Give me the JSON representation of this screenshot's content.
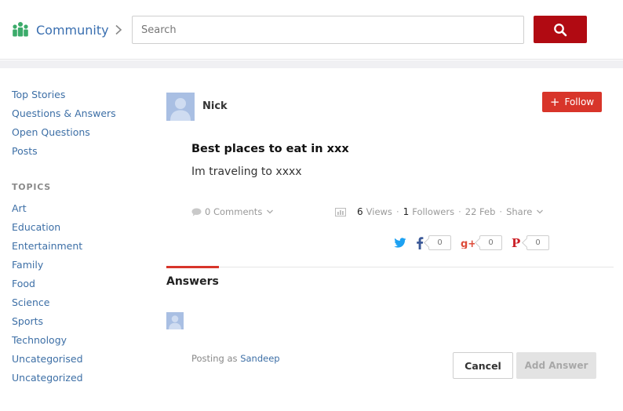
{
  "header": {
    "brand_label": "Community",
    "brand_icon": "community-people-icon",
    "search_placeholder": "Search",
    "search_value": "",
    "search_button_icon": "search-icon",
    "accent_color": "#b10a12"
  },
  "sidebar": {
    "nav": [
      {
        "label": "Top Stories"
      },
      {
        "label": "Questions & Answers"
      },
      {
        "label": "Open Questions"
      },
      {
        "label": "Posts"
      }
    ],
    "topics_heading": "TOPICS",
    "topics": [
      {
        "label": "Art"
      },
      {
        "label": "Education"
      },
      {
        "label": "Entertainment"
      },
      {
        "label": "Family"
      },
      {
        "label": "Food"
      },
      {
        "label": "Science"
      },
      {
        "label": "Sports"
      },
      {
        "label": "Technology"
      },
      {
        "label": "Uncategorised"
      },
      {
        "label": "Uncategorized"
      }
    ]
  },
  "post": {
    "author": "Nick",
    "follow_label": "Follow",
    "title": "Best places to eat in xxx",
    "body": "Im traveling to xxxx",
    "comments_label": "0 Comments",
    "views_count": "6",
    "views_label": "Views",
    "followers_count": "1",
    "followers_label": "Followers",
    "date": "22 Feb",
    "share_label": "Share",
    "share": {
      "twitter_icon": "twitter-icon",
      "facebook_count": "0",
      "googleplus_count": "0",
      "pinterest_count": "0"
    }
  },
  "answers": {
    "heading": "Answers",
    "posting_as_prefix": "Posting as",
    "posting_as_user": "Sandeep",
    "cancel_label": "Cancel",
    "add_answer_label": "Add Answer"
  }
}
